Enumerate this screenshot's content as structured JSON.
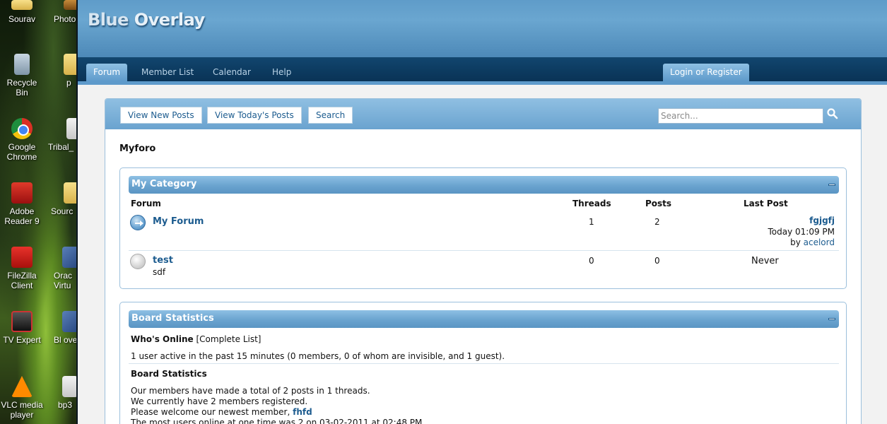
{
  "desktop": {
    "icons": [
      {
        "label": "Sourav",
        "icon": "folder-icon"
      },
      {
        "label": "Recycle Bin",
        "icon": "recycle-bin-icon"
      },
      {
        "label": "Google Chrome",
        "icon": "chrome-icon"
      },
      {
        "label": "Adobe Reader 9",
        "icon": "adobe-reader-icon"
      },
      {
        "label": "FileZilla Client",
        "icon": "filezilla-icon"
      },
      {
        "label": "TV Expert",
        "icon": "tv-icon"
      },
      {
        "label": "VLC media player",
        "icon": "vlc-icon"
      }
    ],
    "icons_col2": [
      {
        "label": "Photo",
        "icon": "photo-icon"
      },
      {
        "label": "p",
        "icon": "folder-icon"
      },
      {
        "label": "Tribal_",
        "icon": "document-icon"
      },
      {
        "label": "Sourc",
        "icon": "folder-icon"
      },
      {
        "label": "Orac Virtu",
        "icon": "virtualbox-icon"
      },
      {
        "label": "Bl overl",
        "icon": "archive-icon"
      },
      {
        "label": "bp3",
        "icon": "document-icon"
      }
    ]
  },
  "header": {
    "logo_part1": "Blue",
    "logo_part2": "Overlay"
  },
  "nav": {
    "tabs": [
      {
        "label": "Forum"
      },
      {
        "label": "Member List"
      },
      {
        "label": "Calendar"
      },
      {
        "label": "Help"
      }
    ],
    "login_label": "Login or Register"
  },
  "toolbar": {
    "buttons": [
      {
        "label": "View New Posts"
      },
      {
        "label": "View Today's Posts"
      },
      {
        "label": "Search"
      }
    ],
    "search_placeholder": "Search..."
  },
  "page_title": "Myforo",
  "category": {
    "title": "My Category",
    "columns": {
      "forum": "Forum",
      "threads": "Threads",
      "posts": "Posts",
      "last_post": "Last Post"
    },
    "forums": [
      {
        "name": "My Forum",
        "description": "",
        "threads": "1",
        "posts": "2",
        "last_post_title": "fgjgfj",
        "last_post_time": "Today 01:09 PM",
        "last_post_by_prefix": "by",
        "last_post_user": "acelord",
        "status": "new"
      },
      {
        "name": "test",
        "description": "sdf",
        "threads": "0",
        "posts": "0",
        "last_post_never": "Never",
        "status": "old"
      }
    ]
  },
  "stats": {
    "title": "Board Statistics",
    "whos_online_label": "Who's Online",
    "complete_list_link": "[Complete List]",
    "active_line": "1 user active in the past 15 minutes (0 members, 0 of whom are invisible, and 1 guest).",
    "board_stats_label": "Board Statistics",
    "line1": "Our members have made a total of 2 posts in 1 threads.",
    "line2": "We currently have 2 members registered.",
    "line3_prefix": "Please welcome our newest member,",
    "newest_member": "fhfd",
    "line4": "The most users online at one time was 2 on 03-02-2011 at 02:48 PM"
  },
  "colors": {
    "accent": "#5e9acb",
    "nav_dark": "#0c3a5f",
    "link": "#1d5c8f"
  }
}
